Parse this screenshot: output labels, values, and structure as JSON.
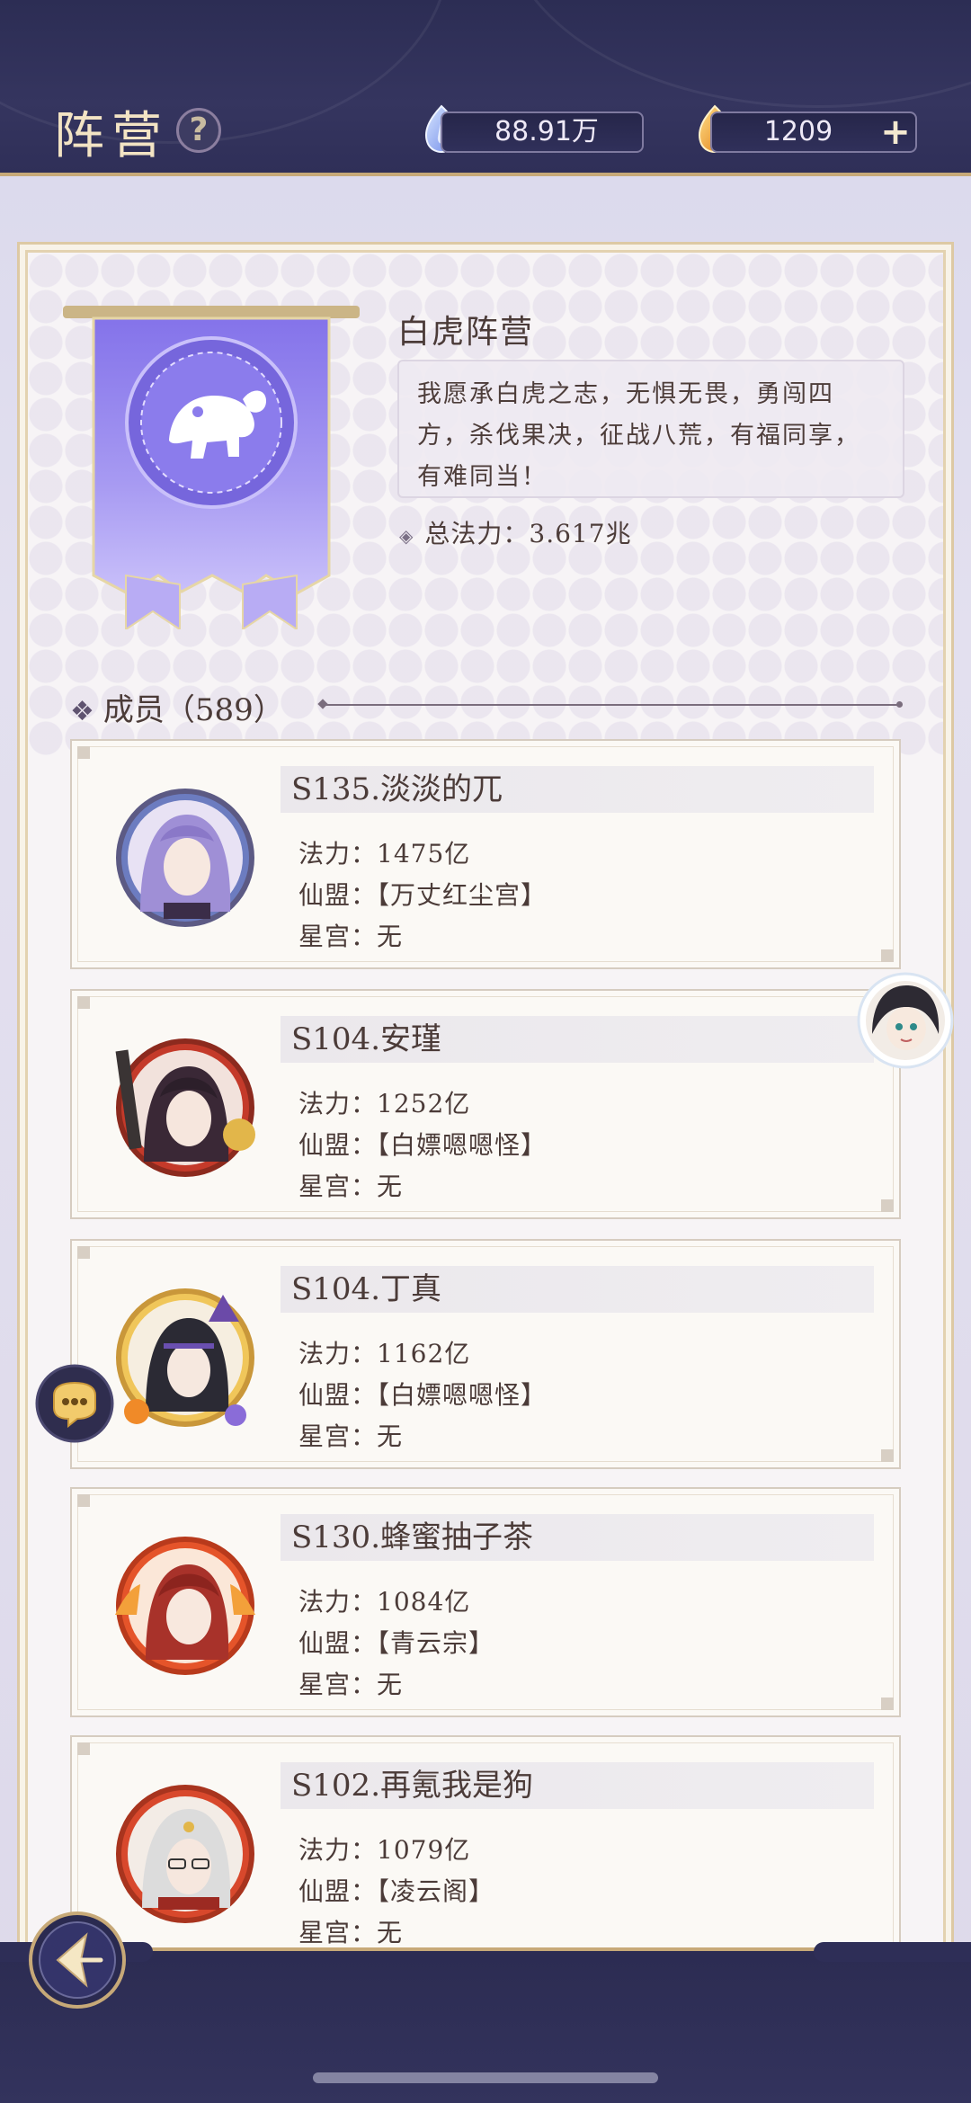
{
  "header": {
    "title": "阵营",
    "help_icon": "question-icon",
    "currency_spirit": "88.91万",
    "currency_gold": "1209",
    "plus_label": "+"
  },
  "faction": {
    "name": "白虎阵营",
    "motto_line1": "我愿承白虎之志，无惧无畏，勇闯四",
    "motto_line2": "方，杀伐果决，征战八荒，有福同享，",
    "motto_line3": "有难同当！",
    "power_label": "总法力：",
    "power_value": "3.617兆",
    "emblem_icon": "white-tiger-icon"
  },
  "members": {
    "heading_label": "成员（",
    "count": "589",
    "heading_close": "）",
    "list": [
      {
        "name": "S135.淡淡的兀",
        "power": "法力：1475亿",
        "alliance": "仙盟：【万丈红尘宫】",
        "palace": "星宫：无"
      },
      {
        "name": "S104.安瑾",
        "power": "法力：1252亿",
        "alliance": "仙盟：【白嫖嗯嗯怪】",
        "palace": "星宫：无"
      },
      {
        "name": "S104.丁真",
        "power": "法力：1162亿",
        "alliance": "仙盟：【白嫖嗯嗯怪】",
        "palace": "星宫：无"
      },
      {
        "name": "S130.蜂蜜抽子茶",
        "power": "法力：1084亿",
        "alliance": "仙盟：【青云宗】",
        "palace": "星宫：无"
      },
      {
        "name": "S102.再氪我是狗",
        "power": "法力：1079亿",
        "alliance": "仙盟：【凌云阁】",
        "palace": "星宫：无"
      }
    ]
  },
  "colors": {
    "header_bg": "#2c2d54",
    "gold_trim": "#c7a978",
    "banner_purple": "#8d7fe8"
  }
}
